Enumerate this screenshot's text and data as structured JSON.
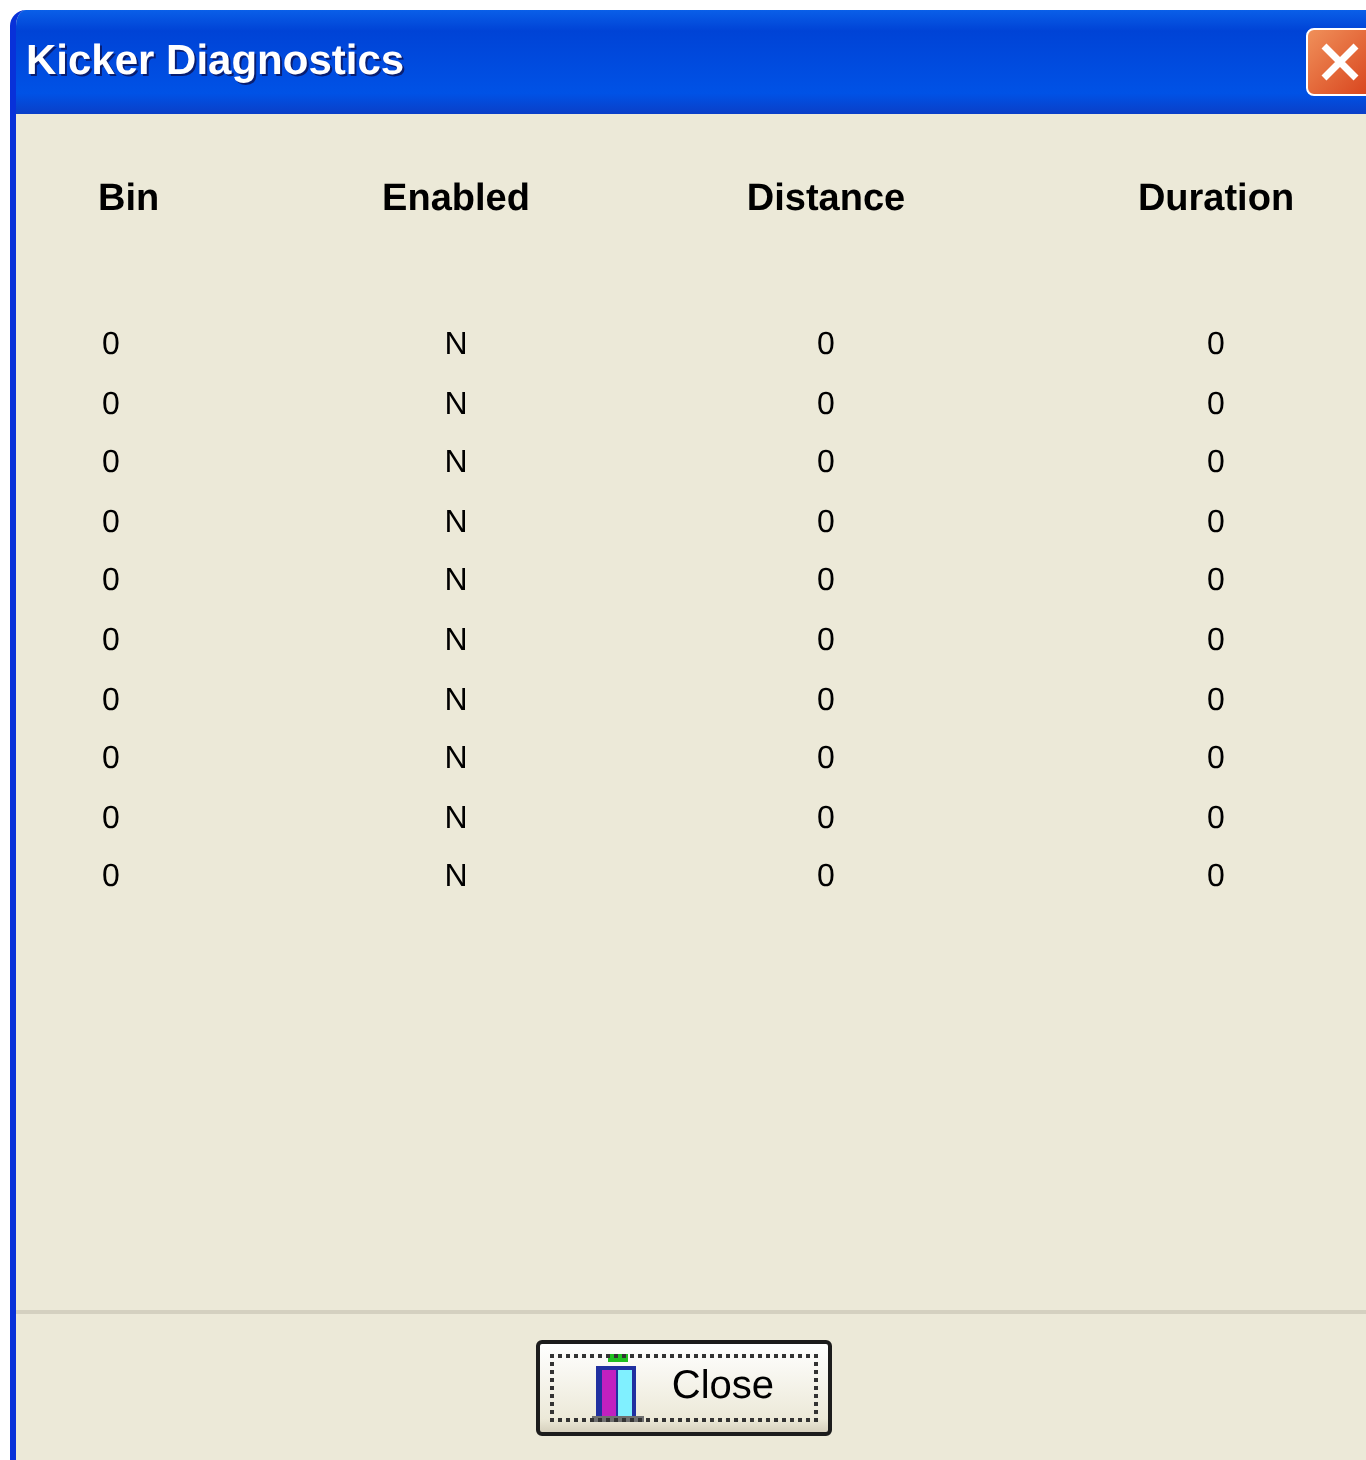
{
  "window": {
    "title": "Kicker Diagnostics"
  },
  "table": {
    "columns": [
      "Bin",
      "Enabled",
      "Distance",
      "Duration"
    ],
    "rows": [
      [
        "0",
        "N",
        "0",
        "0"
      ],
      [
        "0",
        "N",
        "0",
        "0"
      ],
      [
        "0",
        "N",
        "0",
        "0"
      ],
      [
        "0",
        "N",
        "0",
        "0"
      ],
      [
        "0",
        "N",
        "0",
        "0"
      ],
      [
        "0",
        "N",
        "0",
        "0"
      ],
      [
        "0",
        "N",
        "0",
        "0"
      ],
      [
        "0",
        "N",
        "0",
        "0"
      ],
      [
        "0",
        "N",
        "0",
        "0"
      ],
      [
        "0",
        "N",
        "0",
        "0"
      ]
    ]
  },
  "buttons": [
    {
      "label": "Close",
      "focused": true
    }
  ]
}
